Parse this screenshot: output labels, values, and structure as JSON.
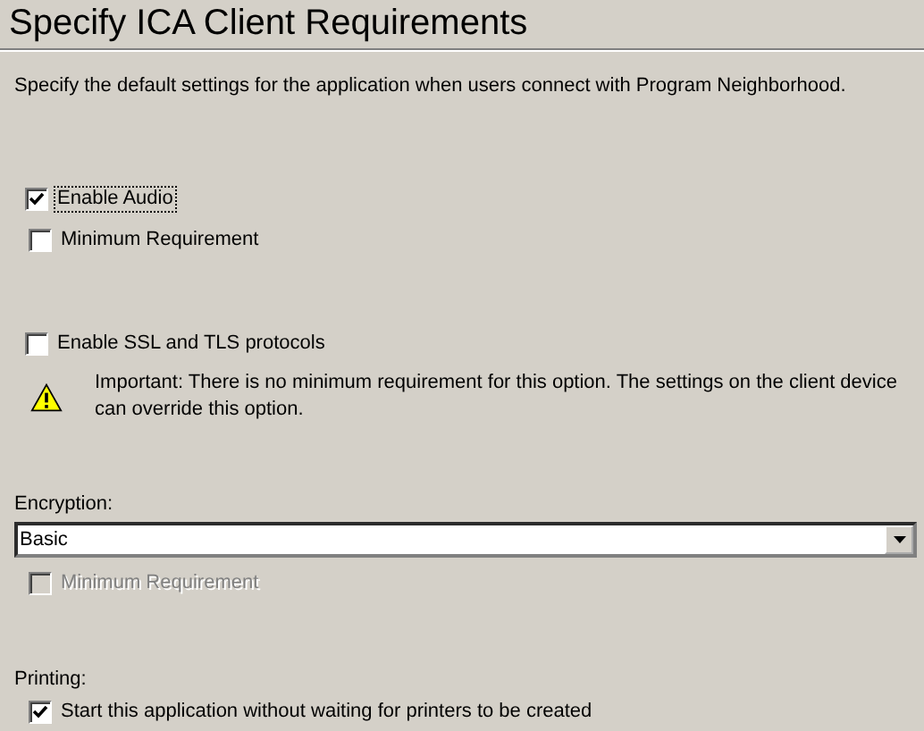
{
  "title": "Specify ICA Client Requirements",
  "description": "Specify the default settings for the application when users connect with Program Neighborhood.",
  "audio": {
    "label": "Enable Audio",
    "checked": true,
    "focused": true,
    "min_requirement": {
      "label": "Minimum Requirement",
      "checked": false,
      "disabled": false
    }
  },
  "ssl": {
    "label": "Enable SSL and TLS protocols",
    "checked": false
  },
  "warning": "Important: There is no minimum requirement for this option. The settings on the client device can override this option.",
  "encryption": {
    "label": "Encryption:",
    "value": "Basic",
    "min_requirement": {
      "label": "Minimum Requirement",
      "checked": false,
      "disabled": true
    }
  },
  "printing": {
    "label": "Printing:",
    "option": {
      "label": "Start this application without waiting for printers to be created",
      "checked": true
    }
  }
}
